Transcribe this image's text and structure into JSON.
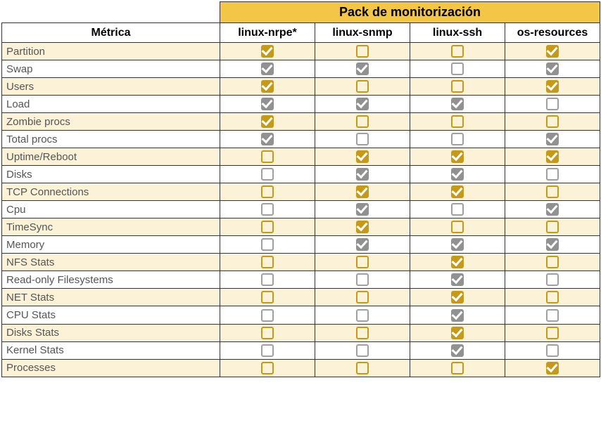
{
  "header": {
    "group_title": "Pack de monitorización",
    "metric_header": "Métrica",
    "packs": [
      "linux-nrpe*",
      "linux-snmp",
      "linux-ssh",
      "os-resources"
    ]
  },
  "rows": [
    {
      "metric": "Partition",
      "cells": [
        "checked-gold",
        "empty-gold",
        "empty-gold",
        "checked-gold"
      ]
    },
    {
      "metric": "Swap",
      "cells": [
        "checked-gray",
        "checked-gray",
        "empty-gray",
        "checked-gray"
      ]
    },
    {
      "metric": "Users",
      "cells": [
        "checked-gold",
        "empty-gold",
        "empty-gold",
        "checked-gold"
      ]
    },
    {
      "metric": "Load",
      "cells": [
        "checked-gray",
        "checked-gray",
        "checked-gray",
        "empty-gray"
      ]
    },
    {
      "metric": "Zombie procs",
      "cells": [
        "checked-gold",
        "empty-gold",
        "empty-gold",
        "empty-gold"
      ]
    },
    {
      "metric": "Total procs",
      "cells": [
        "checked-gray",
        "empty-gray",
        "empty-gray",
        "checked-gray"
      ]
    },
    {
      "metric": "Uptime/Reboot",
      "cells": [
        "empty-gold",
        "checked-gold",
        "checked-gold",
        "checked-gold"
      ]
    },
    {
      "metric": "Disks",
      "cells": [
        "empty-gray",
        "checked-gray",
        "checked-gray",
        "empty-gray"
      ]
    },
    {
      "metric": "TCP Connections",
      "cells": [
        "empty-gold",
        "checked-gold",
        "checked-gold",
        "empty-gold"
      ]
    },
    {
      "metric": "Cpu",
      "cells": [
        "empty-gray",
        "checked-gray",
        "empty-gray",
        "checked-gray"
      ]
    },
    {
      "metric": "TimeSync",
      "cells": [
        "empty-gold",
        "checked-gold",
        "empty-gold",
        "empty-gold"
      ]
    },
    {
      "metric": "Memory",
      "cells": [
        "empty-gray",
        "checked-gray",
        "checked-gray",
        "checked-gray"
      ]
    },
    {
      "metric": "NFS Stats",
      "cells": [
        "empty-gold",
        "empty-gold",
        "checked-gold",
        "empty-gold"
      ]
    },
    {
      "metric": "Read-only Filesystems",
      "cells": [
        "empty-gray",
        "empty-gray",
        "checked-gray",
        "empty-gray"
      ]
    },
    {
      "metric": "NET Stats",
      "cells": [
        "empty-gold",
        "empty-gold",
        "checked-gold",
        "empty-gold"
      ]
    },
    {
      "metric": "CPU Stats",
      "cells": [
        "empty-gray",
        "empty-gray",
        "checked-gray",
        "empty-gray"
      ]
    },
    {
      "metric": "Disks Stats",
      "cells": [
        "empty-gold",
        "empty-gold",
        "checked-gold",
        "empty-gold"
      ]
    },
    {
      "metric": "Kernel Stats",
      "cells": [
        "empty-gray",
        "empty-gray",
        "checked-gray",
        "empty-gray"
      ]
    },
    {
      "metric": "Processes",
      "cells": [
        "empty-gold",
        "empty-gold",
        "empty-gold",
        "checked-gold"
      ]
    }
  ]
}
